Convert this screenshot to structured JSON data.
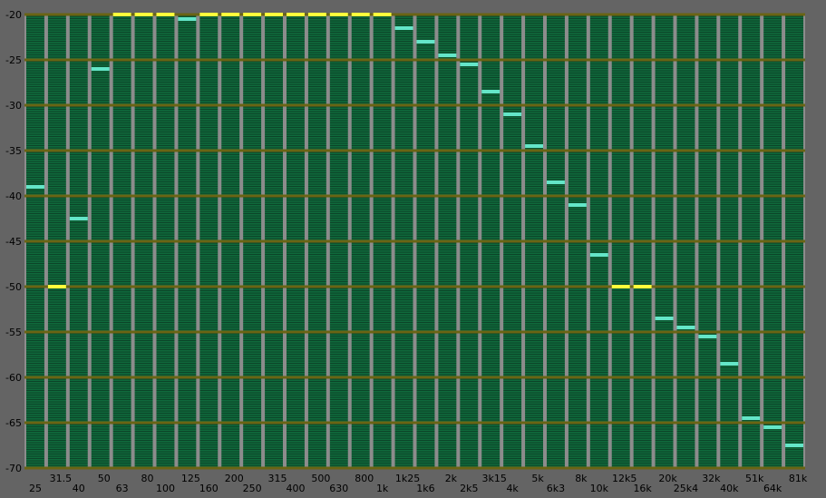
{
  "colors": {
    "window_bg": "#646464",
    "plot_bg": "#1f3c2a",
    "band_fill": "#0f6a3c",
    "band_lines": "#0b3f25",
    "column_gap": "#8c8c8c",
    "major_grid": "#6a6414",
    "peak_normal": "#64e6c8",
    "peak_clip": "#ffff3c",
    "label_text": "#000000"
  },
  "chart_data": {
    "type": "bar",
    "title": "",
    "xlabel": "",
    "ylabel": "",
    "ylim": [
      -70,
      -20
    ],
    "yticks": [
      "-20",
      "-25",
      "-30",
      "-35",
      "-40",
      "-45",
      "-50",
      "-55",
      "-60",
      "-65",
      "-70"
    ],
    "grid": true,
    "categories": [
      "25",
      "31.5",
      "40",
      "50",
      "63",
      "80",
      "100",
      "125",
      "160",
      "200",
      "250",
      "315",
      "400",
      "500",
      "630",
      "800",
      "1k",
      "1k25",
      "1k6",
      "2k",
      "2k5",
      "3k15",
      "4k",
      "5k",
      "6k3",
      "8k",
      "10k",
      "12k5",
      "16k",
      "20k",
      "25k4",
      "32k",
      "40k",
      "51k",
      "64k",
      "81k"
    ],
    "series": [
      {
        "values": [
          -39,
          -50,
          -42.5,
          -26,
          -20,
          -20,
          -20,
          -20.5,
          -20,
          -20,
          -20,
          -20,
          -20,
          -20,
          -20,
          -20,
          -20,
          -21.5,
          -23,
          -24.5,
          -25.5,
          -28.5,
          -31,
          -34.5,
          -38.5,
          -41,
          -46.5,
          -50,
          -50,
          -53.5,
          -54.5,
          -55.5,
          -58.5,
          -64.5,
          -65.5,
          -67.5
        ],
        "highlight": [
          false,
          true,
          false,
          false,
          true,
          true,
          true,
          false,
          true,
          true,
          true,
          true,
          true,
          true,
          true,
          true,
          true,
          false,
          false,
          false,
          false,
          false,
          false,
          false,
          false,
          false,
          false,
          true,
          true,
          false,
          false,
          false,
          false,
          false,
          false,
          false
        ]
      }
    ]
  }
}
